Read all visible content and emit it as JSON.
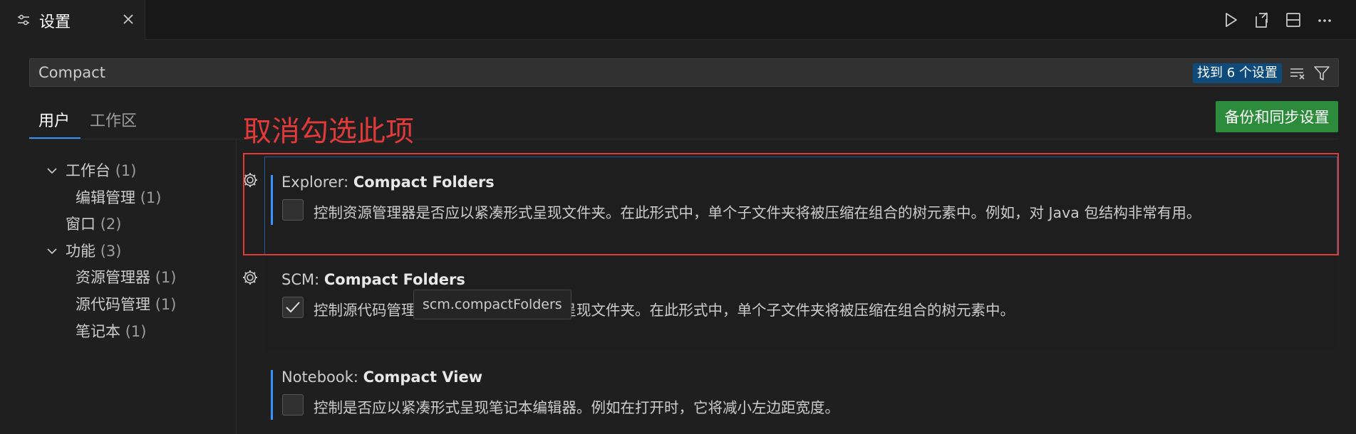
{
  "tab": {
    "title": "设置",
    "icon": "settings-sliders-icon"
  },
  "title_actions": [
    "run-icon",
    "open-json-icon",
    "split-editor-icon",
    "more-actions-icon"
  ],
  "search": {
    "value": "Compact",
    "results_label": "找到 6 个设置",
    "clear_icon": "clear-filter-icon",
    "filter_icon": "filter-icon"
  },
  "scope_tabs": [
    "用户",
    "工作区"
  ],
  "annotation": "取消勾选此项",
  "sync_button": "备份和同步设置",
  "toc": [
    {
      "label": "工作台",
      "count": "(1)",
      "expanded": true
    },
    {
      "label": "编辑管理",
      "count": "(1)"
    },
    {
      "label": "窗口",
      "count": "(2)"
    },
    {
      "label": "功能",
      "count": "(3)",
      "expanded": true
    },
    {
      "label": "资源管理器",
      "count": "(1)"
    },
    {
      "label": "源代码管理",
      "count": "(1)"
    },
    {
      "label": "笔记本",
      "count": "(1)"
    }
  ],
  "settings": [
    {
      "category": "Explorer: ",
      "name": "Compact Folders",
      "checked": false,
      "description": "控制资源管理器是否应以紧凑形式呈现文件夹。在此形式中，单个子文件夹将被压缩在组合的树元素中。例如，对 Java 包结构非常有用。"
    },
    {
      "category": "SCM: ",
      "name": "Compact Folders",
      "checked": true,
      "description": "控制源代码管理视图是否应以紧凑形式呈现文件夹。在此形式中，单个子文件夹将被压缩在组合的树元素中。"
    },
    {
      "category": "Notebook: ",
      "name": "Compact View",
      "checked": false,
      "description": "控制是否应以紧凑形式呈现笔记本编辑器。例如在打开时，它将减小左边距宽度。"
    }
  ],
  "tooltip": "scm.compactFolders"
}
